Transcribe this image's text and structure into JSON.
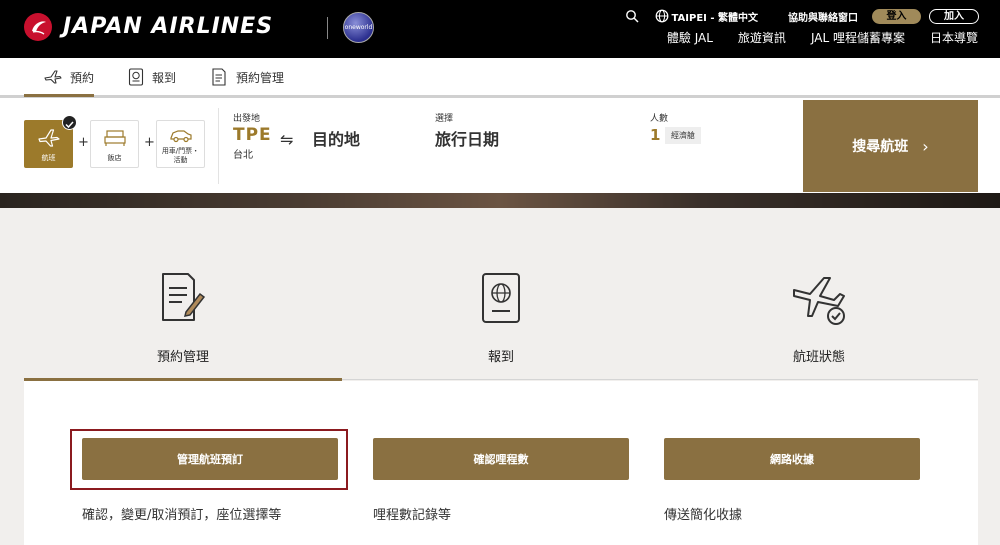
{
  "header": {
    "brand": "JAPAN AIRLINES",
    "alliance_logo_text": "oneworld",
    "util": {
      "region": "TAIPEI - 繁體中文",
      "help": "協助與聯絡窗口",
      "login": "登入",
      "join": "加入"
    },
    "nav": [
      "體驗 JAL",
      "旅遊資訊",
      "JAL 哩程儲蓄專案",
      "日本導覽"
    ]
  },
  "tabs": {
    "booking": "預約",
    "checkin": "報到",
    "manage": "預約管理"
  },
  "widget": {
    "products": {
      "flight": "航班",
      "hotel": "飯店",
      "car_line1": "用車/門票・",
      "car_line2": "活動"
    },
    "plus": "+",
    "origin_label": "出發地",
    "origin_code": "TPE",
    "origin_city": "台北",
    "swap_symbol": "⇋",
    "destination": "目的地",
    "dates_label": "選擇",
    "dates": "旅行日期",
    "pax_label": "人數",
    "pax_count": "1",
    "cabin": "經濟艙",
    "search_button": "搜尋航班",
    "search_chevron": "›"
  },
  "services": {
    "manage": "預約管理",
    "checkin": "報到",
    "status": "航班狀態"
  },
  "panel": {
    "buttons": [
      "管理航班預訂",
      "確認哩程數",
      "網路收據"
    ],
    "descriptions": [
      "確認，變更/取消預訂，座位選擇等",
      "哩程數記錄等",
      "傳送簡化收據"
    ]
  },
  "colors": {
    "gold": "#8a7041",
    "accent_gold": "#9c7a2b",
    "jal_red": "#c8102e",
    "highlight": "#8b1a1f"
  }
}
